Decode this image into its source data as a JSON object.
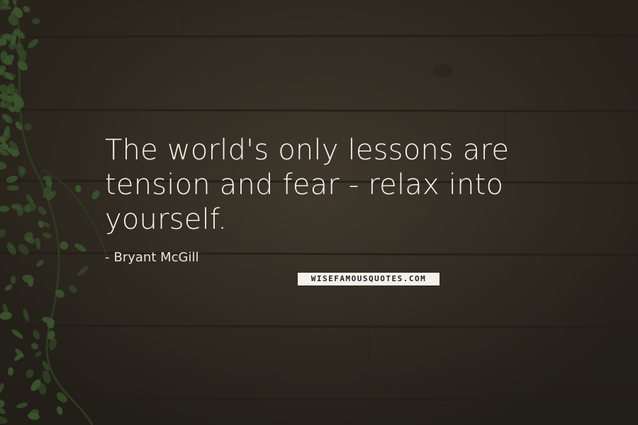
{
  "quote": {
    "line1": "The world's only lessons are",
    "line2": "tension and fear  -  relax into",
    "line3": "yourself."
  },
  "author": {
    "dash": "-",
    "name": "Bryant McGill"
  },
  "watermark": {
    "text": "WISEFAMOUSQUOTES.COM"
  },
  "colors": {
    "background": "#3a3328",
    "text": "#f2efe9",
    "ivy": "#3c5a2e",
    "plank_line": "#231e17"
  },
  "decor": {
    "left_edge": "ivy-vine"
  }
}
